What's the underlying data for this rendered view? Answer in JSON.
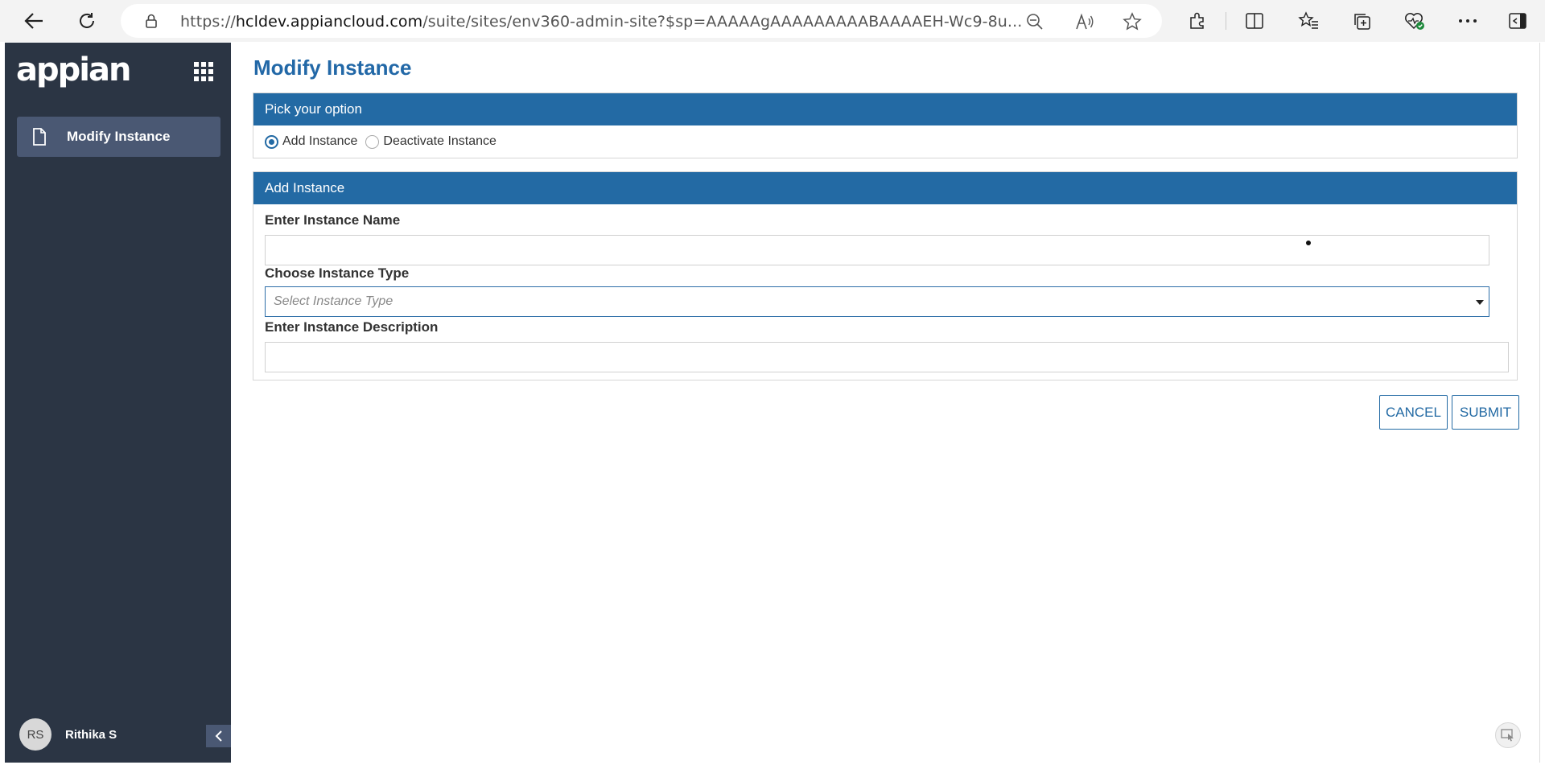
{
  "browser": {
    "url_prefix": "https://",
    "url_host": "hcldev.appiancloud.com",
    "url_rest": "/suite/sites/env360-admin-site?$sp=AAAAAgAAAAAAAAABAAAAEH-Wc9-8u..."
  },
  "sidebar": {
    "logo": "appian",
    "items": [
      {
        "label": "Modify Instance"
      }
    ],
    "user": {
      "initials": "RS",
      "name": "Rithika S"
    }
  },
  "main": {
    "title": "Modify Instance",
    "option_card": {
      "header": "Pick your option",
      "options": [
        {
          "label": "Add Instance",
          "selected": true
        },
        {
          "label": "Deactivate Instance",
          "selected": false
        }
      ]
    },
    "form_card": {
      "header": "Add Instance",
      "name_label": "Enter Instance Name",
      "name_value": "",
      "type_label": "Choose Instance Type",
      "type_placeholder": "Select Instance Type",
      "desc_label": "Enter Instance Description",
      "desc_value": ""
    },
    "actions": {
      "cancel": "CANCEL",
      "submit": "SUBMIT"
    }
  },
  "colors": {
    "accent": "#236aa4",
    "sidebar": "#2b3544",
    "nav_active": "#4a5873"
  }
}
